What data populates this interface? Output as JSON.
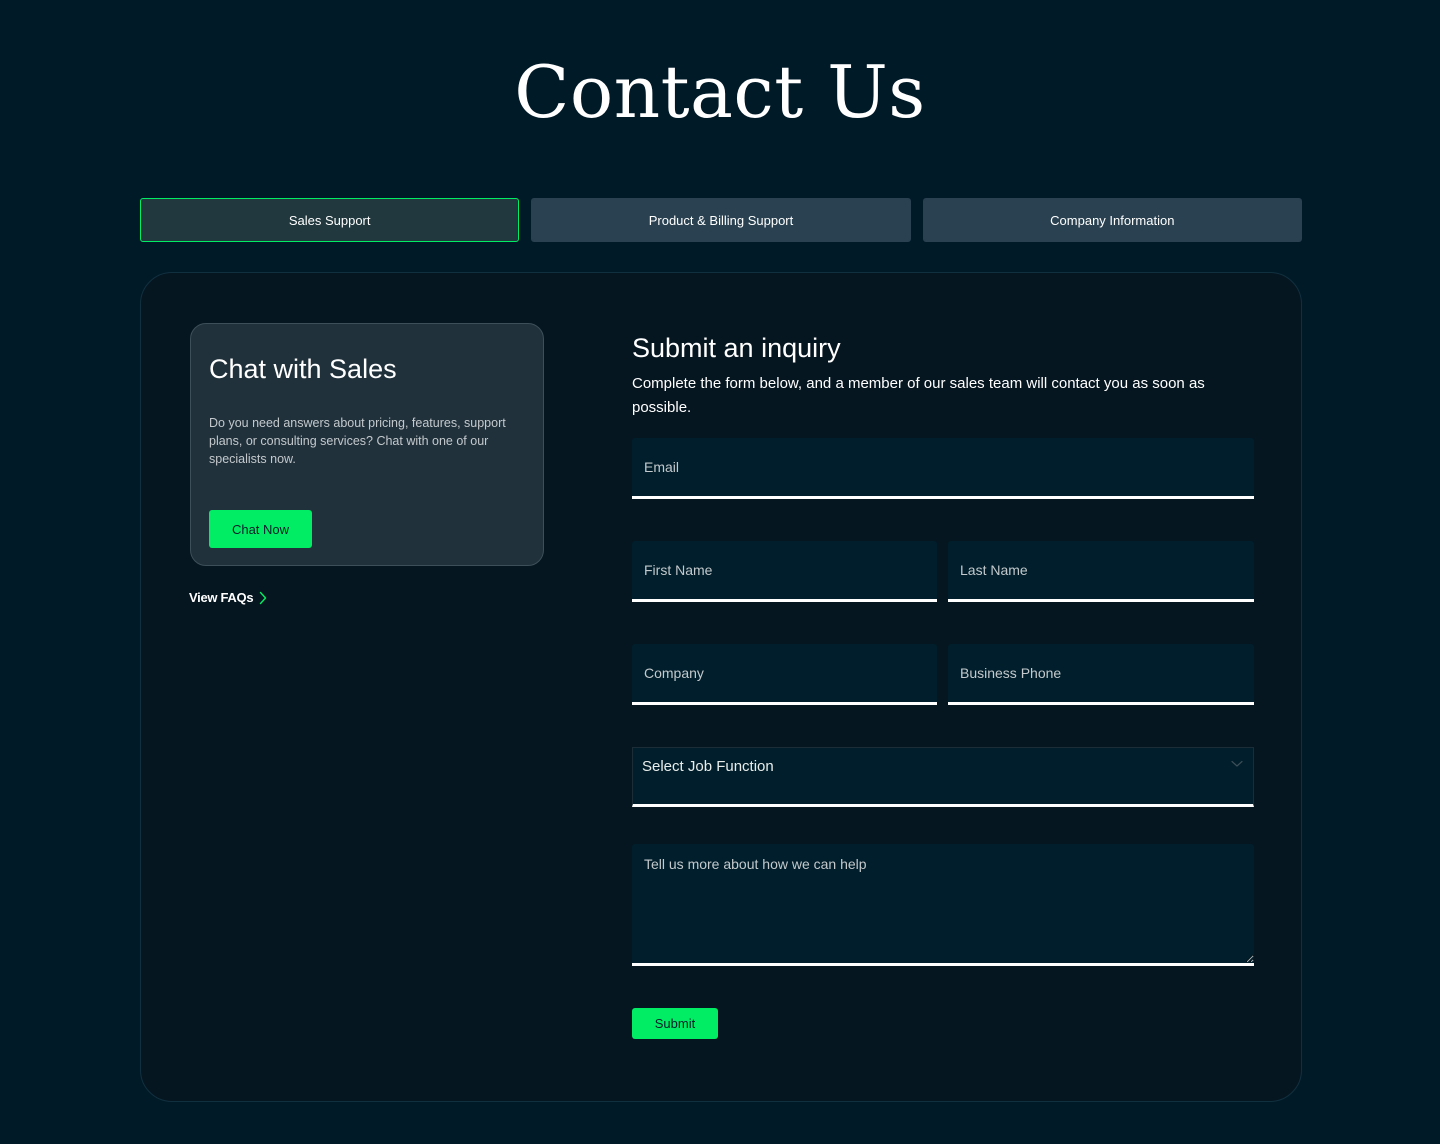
{
  "page": {
    "title": "Contact Us"
  },
  "tabs": [
    {
      "label": "Sales Support",
      "active": true
    },
    {
      "label": "Product & Billing Support",
      "active": false
    },
    {
      "label": "Company Information",
      "active": false
    }
  ],
  "chat": {
    "title": "Chat with Sales",
    "description": "Do you need answers about pricing, features, support plans, or consulting services? Chat with one of our specialists now.",
    "button_label": "Chat Now"
  },
  "faq": {
    "label": "View FAQs",
    "icon": "chevron-right-icon"
  },
  "inquiry": {
    "title": "Submit an inquiry",
    "description": "Complete the form below, and a member of our sales team will contact you as soon as possible."
  },
  "form": {
    "email_placeholder": "Email",
    "first_name_placeholder": "First Name",
    "last_name_placeholder": "Last Name",
    "company_placeholder": "Company",
    "phone_placeholder": "Business Phone",
    "job_function_label": "Select Job Function",
    "message_placeholder": "Tell us more about how we can help",
    "submit_label": "Submit"
  },
  "colors": {
    "background": "#001a28",
    "card": "#061621",
    "accent": "#00ed64",
    "tab": "#294150",
    "chat_box": "#21313c",
    "field": "#001e2b"
  }
}
